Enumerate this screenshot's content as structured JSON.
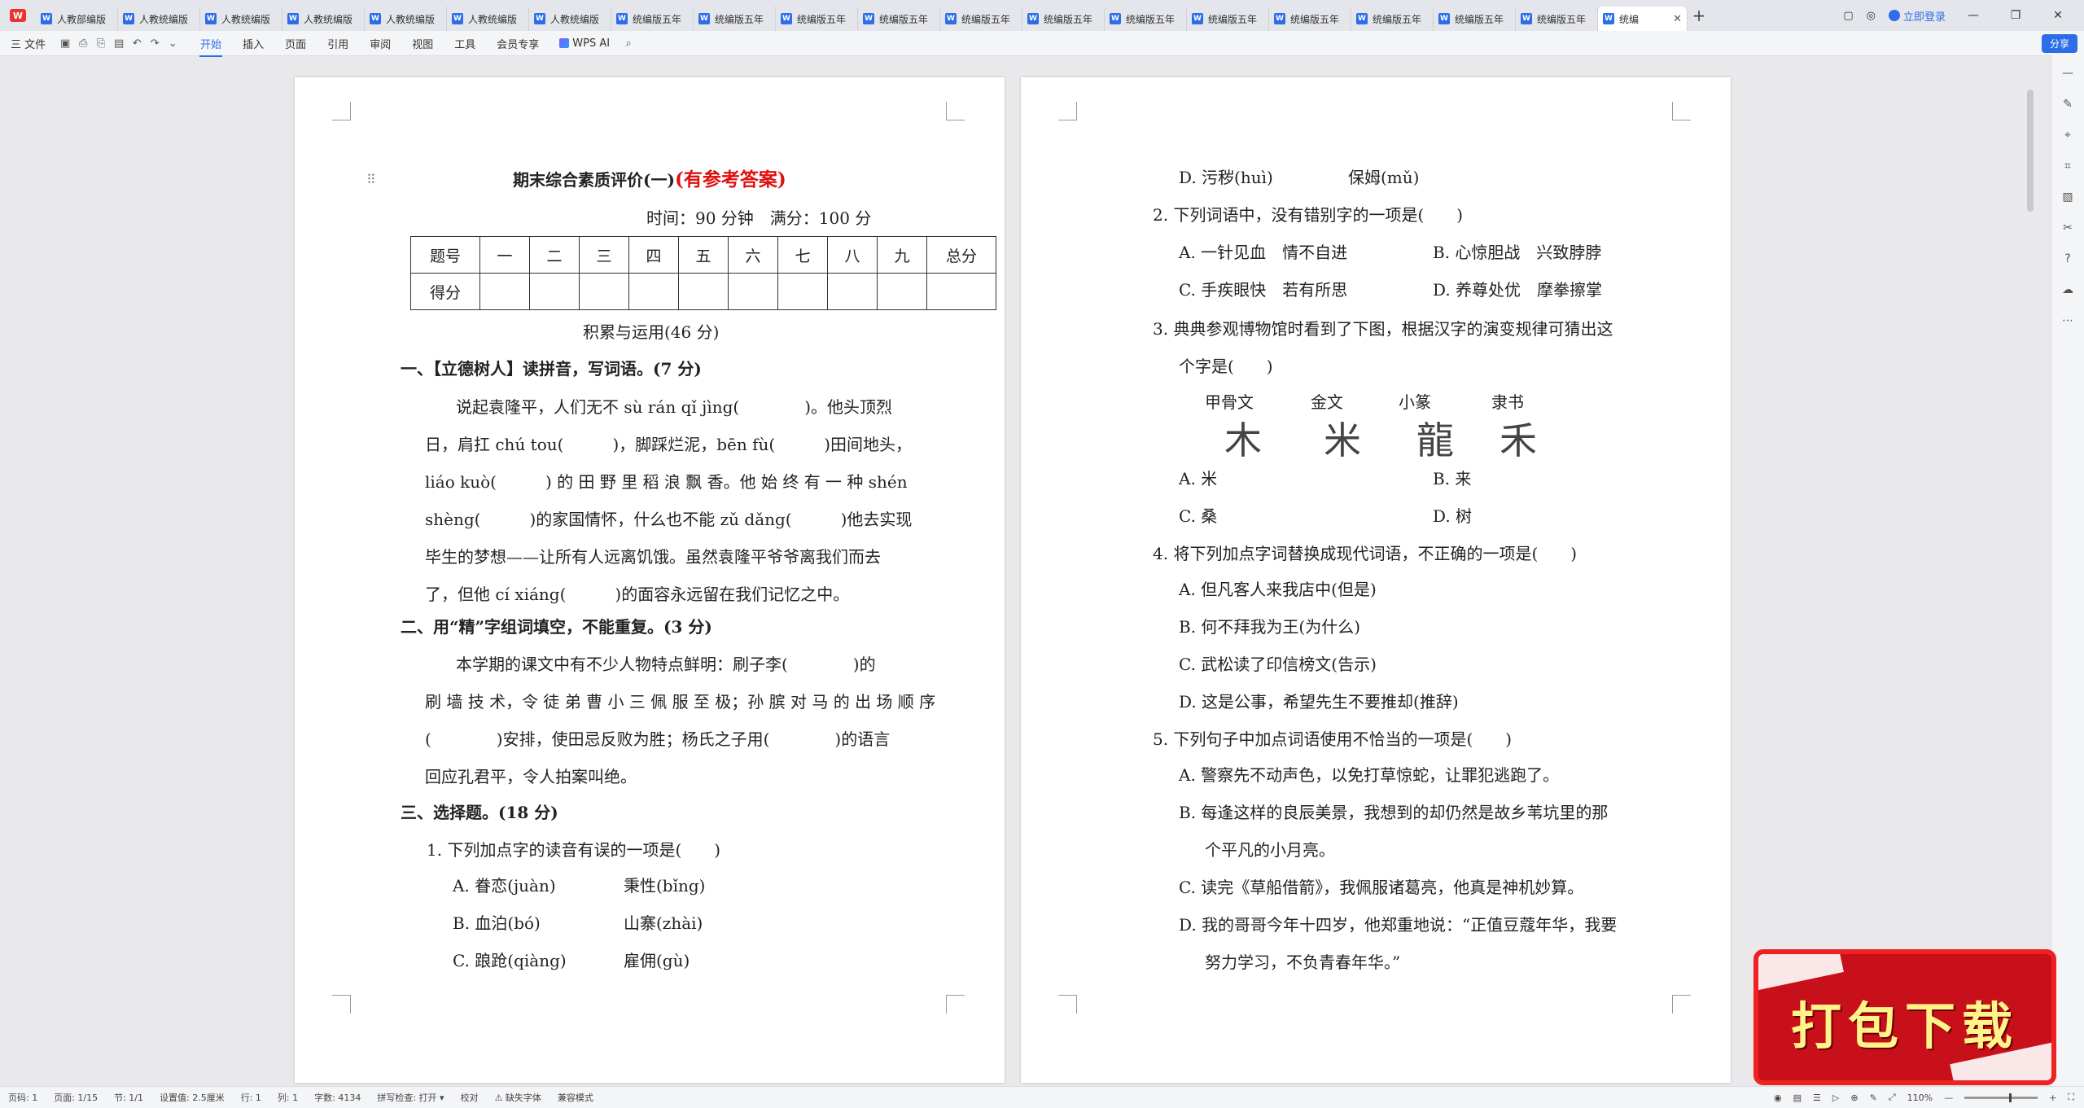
{
  "tabs": [
    "人教部编版",
    "人教统编版",
    "人教统编版",
    "人教统编版",
    "人教统编版",
    "人教统编版",
    "人教统编版",
    "统编版五年",
    "统编版五年",
    "统编版五年",
    "统编版五年",
    "统编版五年",
    "统编版五年",
    "统编版五年",
    "统编版五年",
    "统编版五年",
    "统编版五年",
    "统编版五年",
    "统编版五年"
  ],
  "active_tab": "统编",
  "window": {
    "login": "立即登录",
    "share": "分享"
  },
  "menu": {
    "file": "三 文件",
    "items": [
      "开始",
      "插入",
      "页面",
      "引用",
      "审阅",
      "视图",
      "工具",
      "会员专享"
    ],
    "active": "开始",
    "ai": "WPS AI"
  },
  "page1": {
    "title": "期末综合素质评价(一)",
    "title_red": "(有参考答案)",
    "time": "时间：90 分钟　满分：100 分",
    "score_header": [
      "题号",
      "一",
      "二",
      "三",
      "四",
      "五",
      "六",
      "七",
      "八",
      "九",
      "总分"
    ],
    "score_row": "得分",
    "section": "积累与运用(46 分)",
    "q1_head": "一、【立德树人】读拼音，写词语。(7 分)",
    "q1_lines": [
      "说起袁隆平，人们无不 sù rán qǐ jìng(　　　　)。他头顶烈",
      "日，肩扛 chú tou(　　　)，脚踩烂泥，bēn fù(　　　)田间地头，",
      "liáo kuò(　　　) 的 田 野 里 稻 浪 飘 香。他 始 终 有 一 种 shén",
      "shèng(　　　)的家国情怀，什么也不能 zǔ dǎng(　　　)他去实现",
      "毕生的梦想——让所有人远离饥饿。虽然袁隆平爷爷离我们而去",
      "了，但他 cí xiáng(　　　)的面容永远留在我们记忆之中。"
    ],
    "q2_head": "二、用“精”字组词填空，不能重复。(3 分)",
    "q2_lines": [
      "本学期的课文中有不少人物特点鲜明：刷子李(　　　　)的",
      "刷 墙 技 术，令 徒 弟 曹 小 三 佩 服 至 极；孙 膑 对 马 的 出 场 顺 序",
      "(　　　　)安排，使田忌反败为胜；杨氏之子用(　　　　)的语言",
      "回应孔君平，令人拍案叫绝。"
    ],
    "q3_head": "三、选择题。(18 分)",
    "q3_1": "1. 下列加点字的读音有误的一项是(　　)",
    "q3_1_opts": [
      [
        "A. 眷恋(juàn)",
        "秉性(bǐng)"
      ],
      [
        "B. 血泊(bó)",
        "山寨(zhài)"
      ],
      [
        "C. 踉跄(qiàng)",
        "雇佣(gù)"
      ]
    ]
  },
  "page2": {
    "d_line": [
      "D. 污秽(huì)",
      "保姆(mǔ)"
    ],
    "q2": "2. 下列词语中，没有错别字的一项是(　　)",
    "q2_opts": [
      [
        "A. 一针见血　情不自进",
        "B. 心惊胆战　兴致脖脖"
      ],
      [
        "C. 手疾眼快　若有所思",
        "D. 养尊处优　摩拳擦掌"
      ]
    ],
    "q3a": "3. 典典参观博物馆时看到了下图，根据汉字的演变规律可猜出这",
    "q3b": "个字是(　　)",
    "scripts": [
      "甲骨文",
      "金文",
      "小篆",
      "隶书"
    ],
    "q3_opts": [
      [
        "A. 米",
        "B. 来"
      ],
      [
        "C. 桑",
        "D. 树"
      ]
    ],
    "q4": "4. 将下列加点字词替换成现代词语，不正确的一项是(　　)",
    "q4_opts": [
      "A. 但凡客人来我店中(但是)",
      "B. 何不拜我为王(为什么)",
      "C. 武松读了印信榜文(告示)",
      "D. 这是公事，希望先生不要推却(推辞)"
    ],
    "q5": "5. 下列句子中加点词语使用不恰当的一项是(　　)",
    "q5_opts": [
      "A. 警察先不动声色，以免打草惊蛇，让罪犯逃跑了。",
      "B. 每逢这样的良辰美景，我想到的却仍然是故乡苇坑里的那",
      "个平凡的小月亮。",
      "C. 读完《草船借箭》，我佩服诸葛亮，他真是神机妙算。",
      "D. 我的哥哥今年十四岁，他郑重地说：“正值豆蔻年华，我要",
      "努力学习，不负青春年华。”"
    ]
  },
  "status": [
    "页码: 1",
    "页面: 1/15",
    "节: 1/1",
    "设置值: 2.5厘米",
    "行: 1",
    "列: 1",
    "字数: 4134",
    "拼写检查: 打开 ▾",
    "校对",
    "⚠ 缺失字体",
    "兼容模式"
  ],
  "zoom": "110%",
  "promo": "打包下载"
}
